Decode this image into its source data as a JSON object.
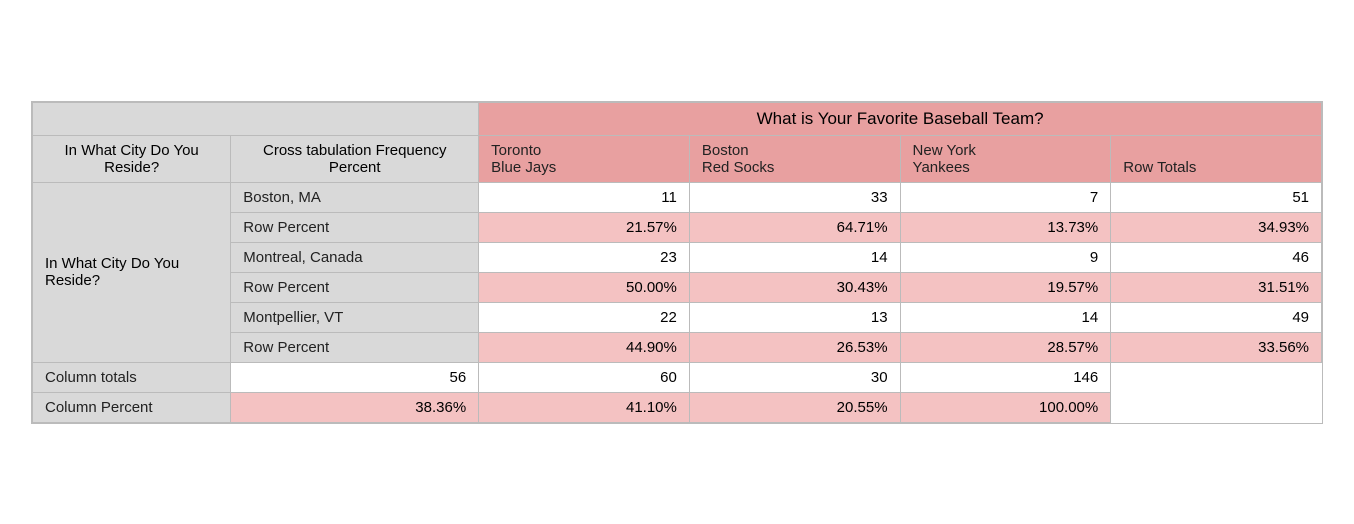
{
  "table": {
    "main_question": "What is Your Favorite Baseball Team?",
    "cross_tab_label": "Cross tabulation Frequency Percent",
    "side_label": "In What City Do You Reside?",
    "col_headers": [
      {
        "line1": "Toronto",
        "line2": "Blue Jays"
      },
      {
        "line1": "Boston",
        "line2": "Red Socks"
      },
      {
        "line1": "New York",
        "line2": "Yankees"
      },
      {
        "line1": "Row Totals",
        "line2": ""
      }
    ],
    "rows": [
      {
        "type": "data",
        "label": "Boston, MA",
        "values": [
          "11",
          "33",
          "7",
          "51"
        ]
      },
      {
        "type": "percent",
        "label": "Row Percent",
        "values": [
          "21.57%",
          "64.71%",
          "13.73%",
          "34.93%"
        ]
      },
      {
        "type": "data",
        "label": "Montreal, Canada",
        "values": [
          "23",
          "14",
          "9",
          "46"
        ]
      },
      {
        "type": "percent",
        "label": "Row Percent",
        "values": [
          "50.00%",
          "30.43%",
          "19.57%",
          "31.51%"
        ]
      },
      {
        "type": "data",
        "label": "Montpellier, VT",
        "values": [
          "22",
          "13",
          "14",
          "49"
        ]
      },
      {
        "type": "percent",
        "label": "Row Percent",
        "values": [
          "44.90%",
          "26.53%",
          "28.57%",
          "33.56%"
        ]
      },
      {
        "type": "data",
        "label": "Column totals",
        "values": [
          "56",
          "60",
          "30",
          "146"
        ]
      },
      {
        "type": "percent",
        "label": "Column Percent",
        "values": [
          "38.36%",
          "41.10%",
          "20.55%",
          "100.00%"
        ]
      }
    ]
  }
}
